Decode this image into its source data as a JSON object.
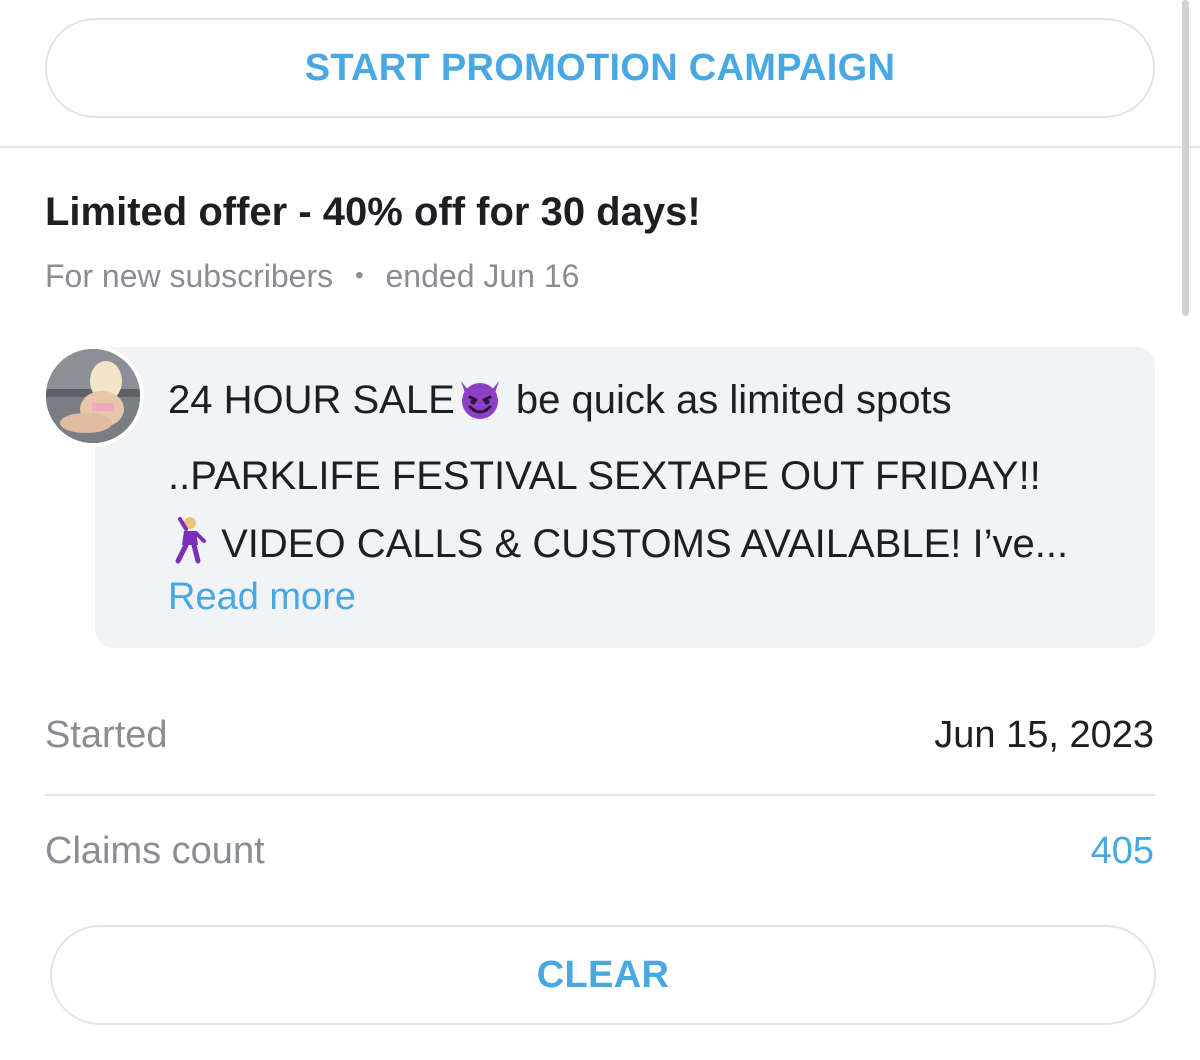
{
  "buttons": {
    "start_promotion": "START PROMOTION CAMPAIGN",
    "clear": "CLEAR"
  },
  "offer": {
    "title": "Limited offer - 40% off for 30 days!",
    "audience": "For new subscribers",
    "separator": "•",
    "status": "ended Jun 16"
  },
  "message": {
    "line1_a": "24 HOUR SALE",
    "line1_b": " be quick as limited spots",
    "line2": "..PARKLIFE FESTIVAL SEXTAPE OUT FRIDAY!!",
    "line3": " VIDEO CALLS & CUSTOMS AVAILABLE! I’ve...",
    "read_more": "Read more",
    "icons": [
      "smiling-devil-icon",
      "dancing-man-icon"
    ]
  },
  "details": {
    "started_label": "Started",
    "started_value": "Jun 15, 2023",
    "claims_label": "Claims count",
    "claims_value": "405"
  },
  "colors": {
    "accent": "#48a8e4",
    "text_primary": "#1e1f22",
    "text_secondary": "#8a8d92",
    "message_bg": "#f2f3f5",
    "divider": "#e6e7e9",
    "devil_purple": "#8e3fc6"
  }
}
